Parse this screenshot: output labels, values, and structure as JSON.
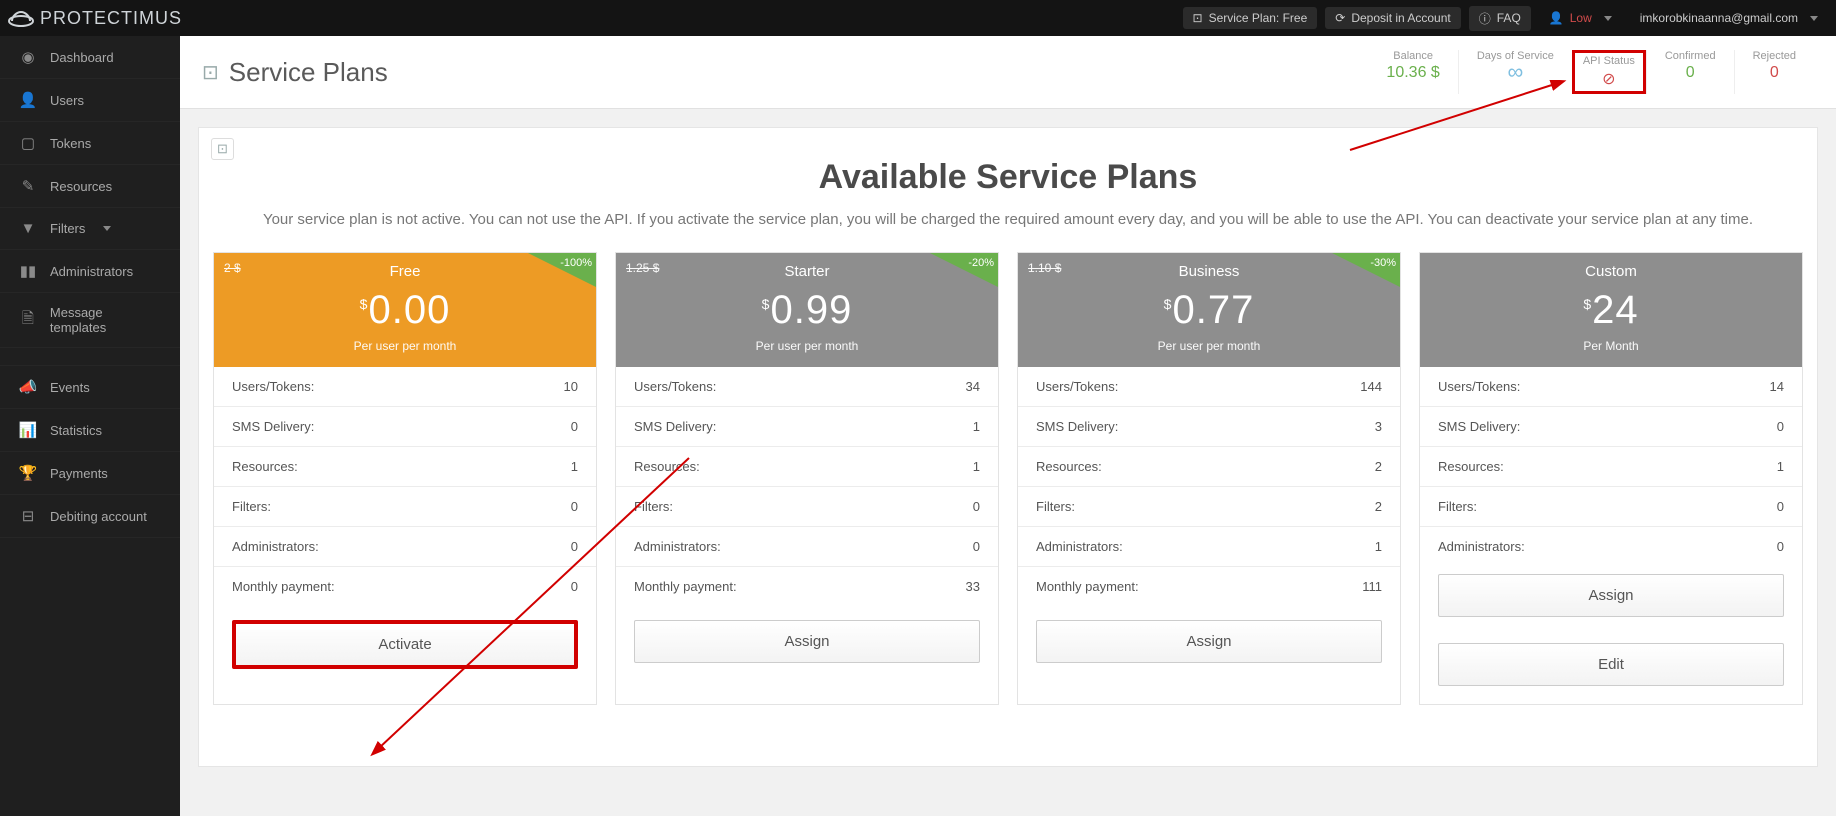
{
  "top": {
    "brand": "PROTECTIMUS",
    "plan_chip": "Service Plan: Free",
    "deposit": "Deposit in Account",
    "faq": "FAQ",
    "security": "Low",
    "email": "imkorobkinaanna@gmail.com"
  },
  "sidebar": {
    "items": [
      {
        "icon": "◉",
        "label": "Dashboard",
        "name": "dashboard"
      },
      {
        "icon": "👤",
        "label": "Users",
        "name": "users"
      },
      {
        "icon": "▢",
        "label": "Tokens",
        "name": "tokens"
      },
      {
        "icon": "✎",
        "label": "Resources",
        "name": "resources"
      },
      {
        "icon": "▼",
        "label": "Filters",
        "name": "filters",
        "caret": true
      },
      {
        "icon": "▮▮",
        "label": "Administrators",
        "name": "administrators"
      },
      {
        "icon": "🗎",
        "label": "Message templates",
        "name": "message-templates"
      }
    ],
    "items2": [
      {
        "icon": "📣",
        "label": "Events",
        "name": "events"
      },
      {
        "icon": "📊",
        "label": "Statistics",
        "name": "statistics"
      },
      {
        "icon": "🏆",
        "label": "Payments",
        "name": "payments"
      },
      {
        "icon": "⊟",
        "label": "Debiting account",
        "name": "debiting"
      }
    ]
  },
  "page": {
    "title": "Service Plans",
    "stats": {
      "balance_label": "Balance",
      "balance_val": "10.36 $",
      "days_label": "Days of Service",
      "days_val": "∞",
      "api_label": "API Status",
      "api_val": "⊘",
      "confirmed_label": "Confirmed",
      "confirmed_val": "0",
      "rejected_label": "Rejected",
      "rejected_val": "0"
    },
    "heading": "Available Service Plans",
    "subtext": "Your service plan is not active. You can not use the API. If you activate the service plan, you will be charged the required amount every day, and you will be able to use the API. You can deactivate your service plan at any time."
  },
  "row_labels": {
    "users": "Users/Tokens:",
    "sms": "SMS Delivery:",
    "resources": "Resources:",
    "filters": "Filters:",
    "admins": "Administrators:",
    "monthly": "Monthly payment:"
  },
  "plans": [
    {
      "name": "Free",
      "old": "2 $",
      "discount": "-100%",
      "price": "0.00",
      "per": "Per user per month",
      "head_class": "orange",
      "users": "10",
      "sms": "0",
      "resources": "1",
      "filters": "0",
      "admins": "0",
      "monthly": "0",
      "button": "Activate",
      "btn_highlight": true
    },
    {
      "name": "Starter",
      "old": "1.25 $",
      "discount": "-20%",
      "price": "0.99",
      "per": "Per user per month",
      "head_class": "",
      "users": "34",
      "sms": "1",
      "resources": "1",
      "filters": "0",
      "admins": "0",
      "monthly": "33",
      "button": "Assign"
    },
    {
      "name": "Business",
      "old": "1.10 $",
      "discount": "-30%",
      "price": "0.77",
      "per": "Per user per month",
      "head_class": "",
      "users": "144",
      "sms": "3",
      "resources": "2",
      "filters": "2",
      "admins": "1",
      "monthly": "111",
      "button": "Assign"
    },
    {
      "name": "Custom",
      "old": "",
      "discount": "",
      "price": "24",
      "per": "Per Month",
      "head_class": "",
      "users": "14",
      "sms": "0",
      "resources": "1",
      "filters": "0",
      "admins": "0",
      "monthly": "",
      "button": "Assign",
      "button2": "Edit"
    }
  ]
}
